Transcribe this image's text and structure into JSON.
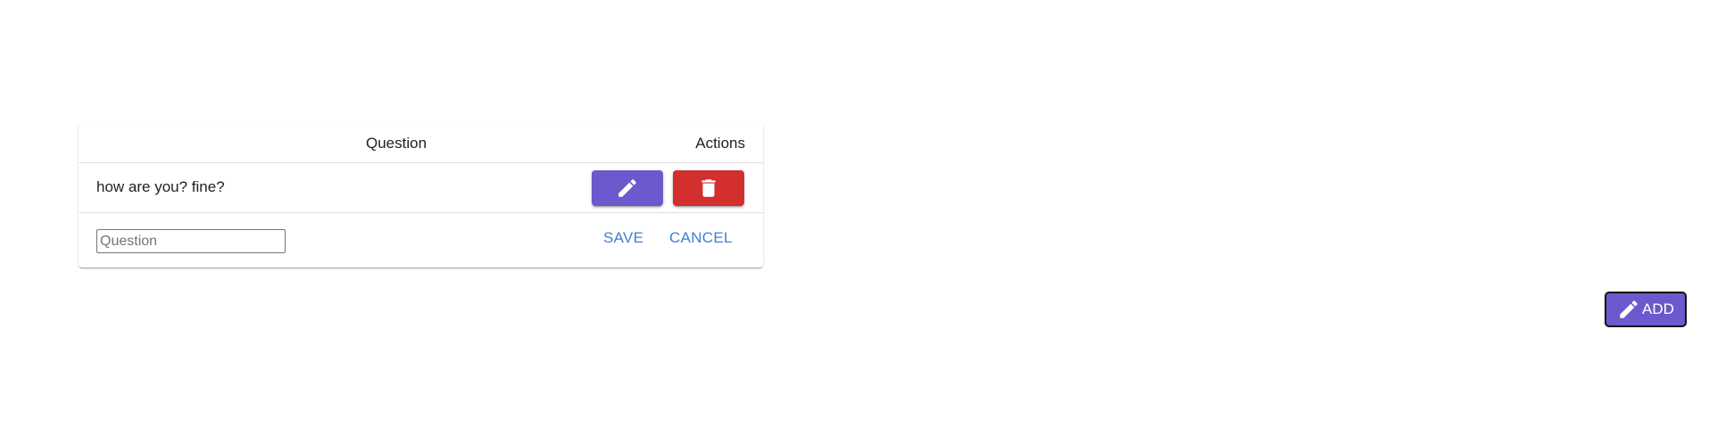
{
  "table": {
    "headers": {
      "question": "Question",
      "actions": "Actions"
    },
    "rows": [
      {
        "question": "how are you? fine?",
        "edit_icon": "pencil-icon",
        "delete_icon": "trash-icon"
      }
    ],
    "edit_row": {
      "input_value": "",
      "input_placeholder": "Question",
      "save_label": "SAVE",
      "cancel_label": "CANCEL"
    }
  },
  "add_button": {
    "label": "ADD",
    "icon": "pencil-icon"
  },
  "colors": {
    "edit": "#6a5acd",
    "delete": "#d32f2f",
    "link": "#3f7fd6"
  }
}
